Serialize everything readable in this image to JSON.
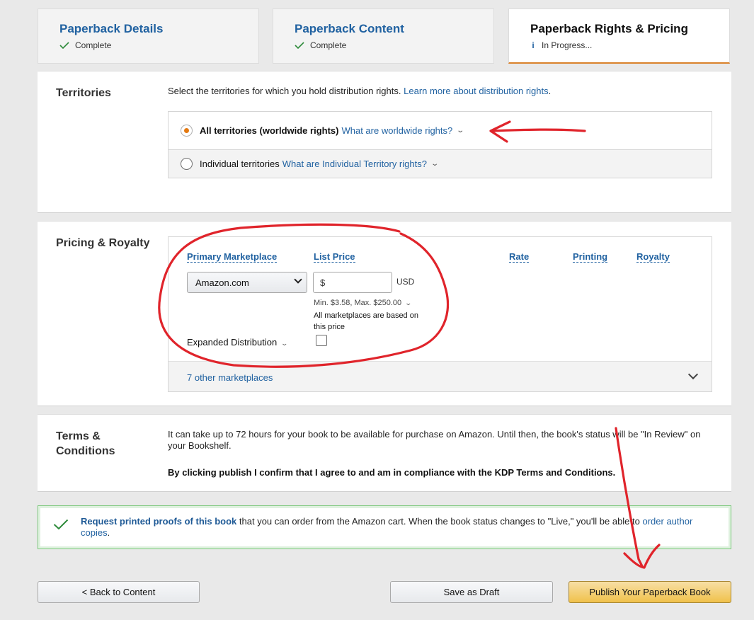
{
  "tabs": [
    {
      "title": "Paperback Details",
      "status": "Complete",
      "state": "complete"
    },
    {
      "title": "Paperback Content",
      "status": "Complete",
      "state": "complete"
    },
    {
      "title": "Paperback Rights & Pricing",
      "status": "In Progress...",
      "state": "in-progress"
    }
  ],
  "territories": {
    "label": "Territories",
    "intro": "Select the territories for which you hold distribution rights.",
    "learn_more": "Learn more about distribution rights",
    "intro_end": ".",
    "options": [
      {
        "label": "All territories (worldwide rights)",
        "help": "What are worldwide rights?",
        "selected": true
      },
      {
        "label": "Individual territories",
        "help": "What are Individual Territory rights?",
        "selected": false
      }
    ]
  },
  "pricing": {
    "label": "Pricing & Royalty",
    "columns": {
      "marketplace": "Primary Marketplace",
      "list_price": "List Price",
      "rate": "Rate",
      "printing": "Printing",
      "royalty": "Royalty"
    },
    "marketplace_value": "Amazon.com",
    "price_placeholder": "$",
    "currency": "USD",
    "min_max": "Min. $3.58, Max. $250.00",
    "all_marketplaces_note": "All marketplaces are based on this price",
    "expanded_distribution": "Expanded Distribution",
    "expanded_checked": false,
    "other_marketplaces": "7 other marketplaces"
  },
  "terms": {
    "label": "Terms & Conditions",
    "text": "It can take up to 72 hours for your book to be available for purchase on Amazon. Until then, the book's status will be \"In Review\" on your Bookshelf.",
    "confirm": "By clicking publish I confirm that I agree to and am in compliance with the KDP Terms and Conditions."
  },
  "proof": {
    "link": "Request printed proofs of this book",
    "text": " that you can order from the Amazon cart. When the book status changes to \"Live,\" you'll be able to ",
    "link2": "order author copies",
    "end": "."
  },
  "buttons": {
    "back": "< Back to Content",
    "draft": "Save as Draft",
    "publish": "Publish Your Paperback Book"
  },
  "colors": {
    "link": "#2162a1",
    "accent_orange": "#e47911",
    "annotation_red": "#e0242b",
    "success_green": "#2e8b3b"
  }
}
